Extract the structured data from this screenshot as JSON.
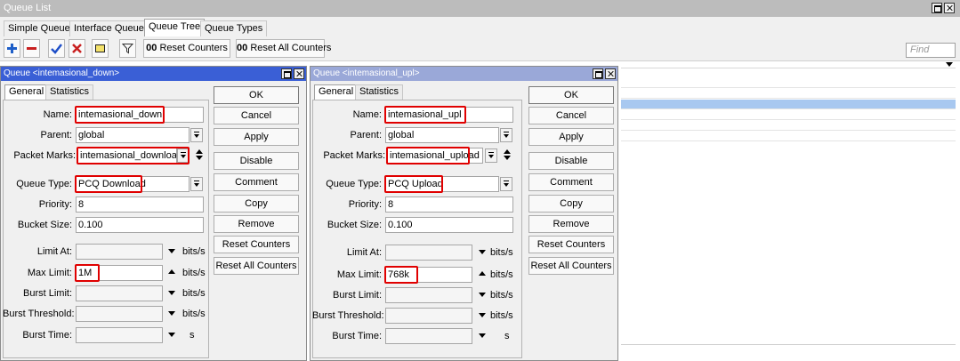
{
  "window": {
    "title": "Queue List"
  },
  "tabs": [
    "Simple Queues",
    "Interface Queues",
    "Queue Tree",
    "Queue Types"
  ],
  "toolbar": {
    "icons": [
      "plus-icon",
      "minus-icon",
      "check-icon",
      "x-icon",
      "note-icon",
      "filter-icon"
    ],
    "reset_counters": "Reset Counters",
    "reset_all_counters": "Reset All Counters",
    "oo_glyph": "00",
    "find_placeholder": "Find"
  },
  "colors": {
    "dialog_title_active": "#3a5fd6",
    "dialog_title_inactive": "#9aa8d8",
    "highlight": "#e00000",
    "selected_row": "#a8c8f0"
  },
  "dialog_down": {
    "title": "Queue <intemasional_down>",
    "tabs": [
      "General",
      "Statistics"
    ],
    "labels": {
      "name": "Name:",
      "parent": "Parent:",
      "packet_marks": "Packet Marks:",
      "queue_type": "Queue Type:",
      "priority": "Priority:",
      "bucket_size": "Bucket Size:",
      "limit_at": "Limit At:",
      "max_limit": "Max Limit:",
      "burst_limit": "Burst Limit:",
      "burst_threshold": "Burst Threshold:",
      "burst_time": "Burst Time:"
    },
    "values": {
      "name": "intemasional_down",
      "parent": "global",
      "packet_marks": "intemasional_download",
      "queue_type": "PCQ Download",
      "priority": "8",
      "bucket_size": "0.100",
      "max_limit": "1M"
    },
    "units": {
      "bits": "bits/s",
      "seconds": "s"
    },
    "buttons": [
      "OK",
      "Cancel",
      "Apply",
      "Disable",
      "Comment",
      "Copy",
      "Remove",
      "Reset Counters",
      "Reset All Counters"
    ]
  },
  "dialog_up": {
    "title": "Queue <intemasional_upl>",
    "tabs": [
      "General",
      "Statistics"
    ],
    "labels": {
      "name": "Name:",
      "parent": "Parent:",
      "packet_marks": "Packet Marks:",
      "queue_type": "Queue Type:",
      "priority": "Priority:",
      "bucket_size": "Bucket Size:",
      "limit_at": "Limit At:",
      "max_limit": "Max Limit:",
      "burst_limit": "Burst Limit:",
      "burst_threshold": "Burst Threshold:",
      "burst_time": "Burst Time:"
    },
    "values": {
      "name": "intemasional_upl",
      "parent": "global",
      "packet_marks": "intemasional_upload",
      "queue_type": "PCQ Upload",
      "priority": "8",
      "bucket_size": "0.100",
      "max_limit": "768k"
    },
    "units": {
      "bits": "bits/s",
      "seconds": "s"
    },
    "buttons": [
      "OK",
      "Cancel",
      "Apply",
      "Disable",
      "Comment",
      "Copy",
      "Remove",
      "Reset Counters",
      "Reset All Counters"
    ]
  }
}
